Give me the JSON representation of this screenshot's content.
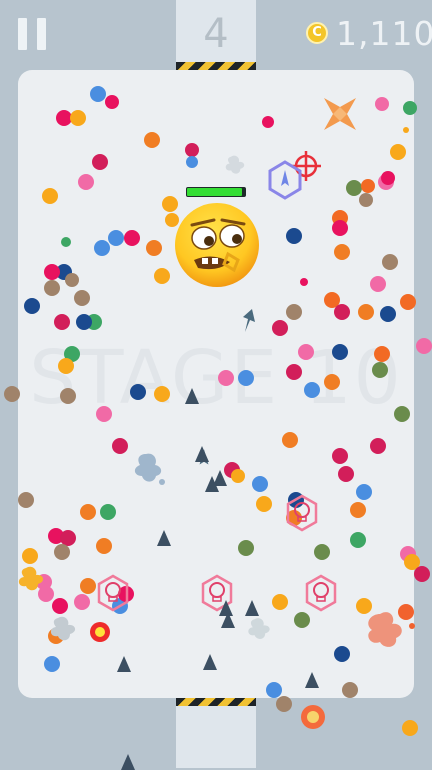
{
  "hud": {
    "level_number": "4",
    "coin_glyph": "C",
    "coins": "1,110"
  },
  "board": {
    "watermark": "STAGE 10",
    "boss_health": 0.95
  },
  "colors": {
    "background": "#b7c4ce",
    "arena": "#eceff2",
    "health": "#33dd33",
    "coin": "#f3c529",
    "dots": [
      "#e8125f",
      "#f07d24",
      "#f8a81b",
      "#4a8ee0",
      "#1b4a8f",
      "#f16aa6",
      "#3da664",
      "#f26a24",
      "#a0836a",
      "#d21e5a",
      "#6a8c4c"
    ]
  },
  "icons": [
    "pause-icon",
    "coin-icon",
    "emoji-boss-icon",
    "crosshair-icon",
    "hexagon-blue-icon",
    "skull-hexagon-icon",
    "star-powerup-icon",
    "paint-splat-icon",
    "spike-enemy-icon",
    "dart-icon",
    "sun-orb-icon"
  ]
}
